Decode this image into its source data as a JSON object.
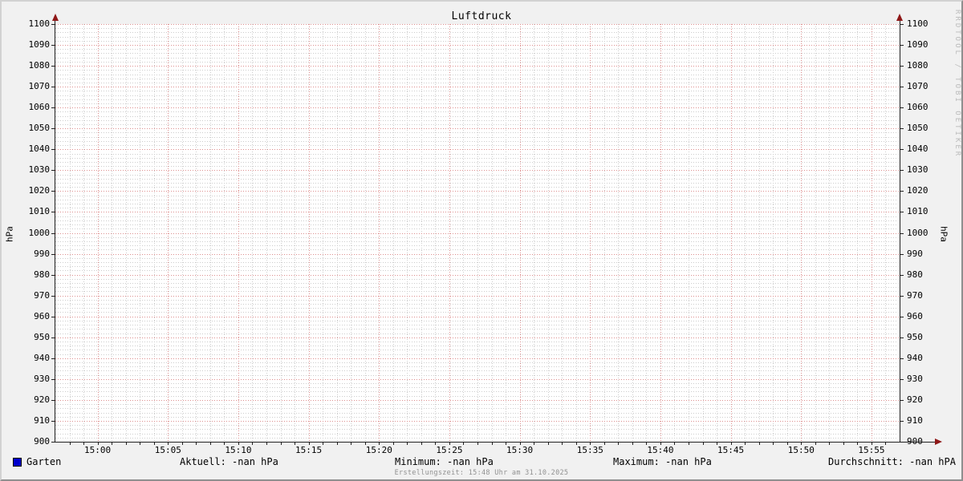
{
  "title": "Luftdruck",
  "vertical_label_left": "hPa",
  "vertical_label_right": "hPa",
  "watermark": "RRDTOOL / TOBI OETIKER",
  "footer": "Erstellungszeit: 15:48 Uhr am 31.10.2025",
  "legend": {
    "series": {
      "label": "Garten",
      "color": "#0000cc"
    },
    "stats": [
      {
        "name": "aktuell",
        "text": "Aktuell: -nan hPa"
      },
      {
        "name": "minimum",
        "text": "Minimum: -nan hPa"
      },
      {
        "name": "maximum",
        "text": "Maximum: -nan hPa"
      },
      {
        "name": "durchschnitt",
        "text": "Durchschnitt: -nan hPA"
      }
    ]
  },
  "colors": {
    "background": "#f1f1f1",
    "canvas": "#ffffff",
    "major_grid": "#dd8f8f",
    "minor_grid": "#cdcdcd",
    "axis": "#1f1f1f",
    "arrow": "#8f1818",
    "series": "#0000cc",
    "watermark_text": "#bcbcbc",
    "footer_text": "#919191"
  },
  "chart_data": {
    "type": "line",
    "title": "Luftdruck",
    "xlabel": "",
    "ylabel": "hPa",
    "ylim": [
      900,
      1100
    ],
    "y_major_step": 10,
    "y_minor_step": 2,
    "x_range": [
      "14:57",
      "15:57"
    ],
    "x_ticks": [
      "15:00",
      "15:05",
      "15:10",
      "15:15",
      "15:20",
      "15:25",
      "15:30",
      "15:35",
      "15:40",
      "15:45",
      "15:50",
      "15:55"
    ],
    "x_major_step_minutes": 5,
    "x_minor_step_minutes": 1,
    "grid": true,
    "legend_position": "bottom",
    "series": [
      {
        "name": "Garten",
        "color": "#0000cc",
        "values": []
      }
    ],
    "stats_shown": {
      "aktuell": "-nan",
      "minimum": "-nan",
      "maximum": "-nan",
      "durchschnitt": "-nan",
      "unit": "hPa"
    }
  }
}
